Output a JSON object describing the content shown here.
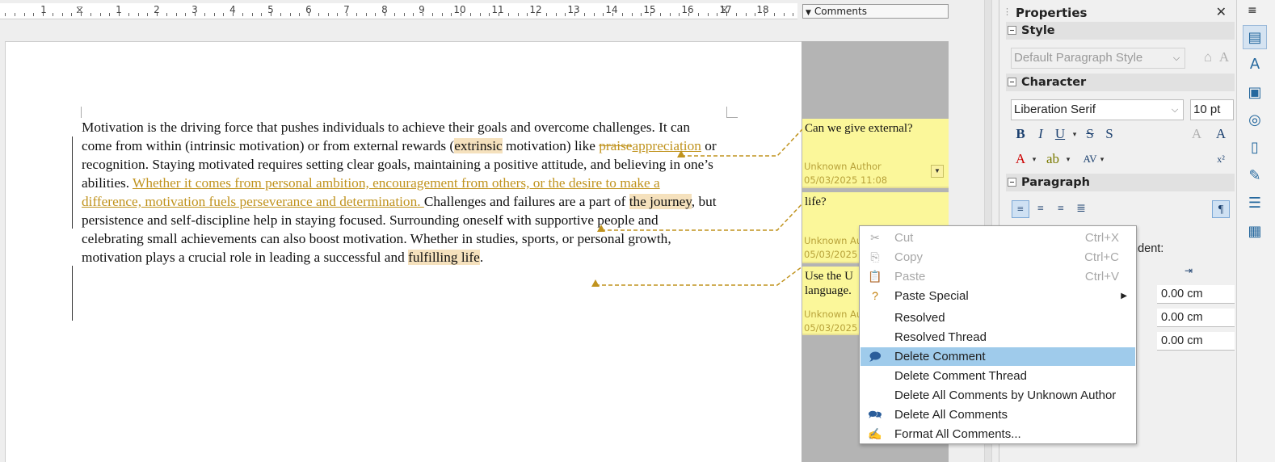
{
  "ruler": {
    "numbers": [
      "1",
      "1",
      "2",
      "3",
      "4",
      "5",
      "6",
      "7",
      "8",
      "9",
      "10",
      "11",
      "12",
      "13",
      "14",
      "15",
      "16",
      "17",
      "18"
    ],
    "comments_dropdown": "Comments"
  },
  "document": {
    "p1": "Motivation is the driving force that pushes individuals to achieve their goals and overcome challenges. It can come from within (intrinsic motivation) or from external rewards (",
    "hl1": "extrinsic",
    "p2": " motivation) like ",
    "del1": "praise",
    "ins1": "appreciation",
    "p3": " or recognition. Staying motivated requires setting clear goals, maintaining a positive attitude, and believing in one’s abilities. ",
    "ins2": "Whether it comes from personal ambition, encouragement from others, or the desire to make a difference, motivation fuels perseverance and determination. ",
    "p4": "Challenges and failures are a part of ",
    "hl2": "the journey",
    "p5": ", but persistence and self-discipline help in staying focused. Surrounding oneself with supportive people and celebrating small achievements can also boost motivation. Whether in studies, sports, or personal growth, motivation plays a crucial role in leading a successful and ",
    "hl3": "fulfilling life",
    "p6": "."
  },
  "comments": [
    {
      "text": "Can we give external?",
      "author": "Unknown Author",
      "date": "05/03/2025 11:08"
    },
    {
      "text": "life?",
      "author": "Unknown Au",
      "date": "05/03/2025"
    },
    {
      "text": "Use the U",
      "text2": "language.",
      "author": "Unknown Au",
      "date": "05/03/2025"
    }
  ],
  "context_menu": {
    "cut": "Cut",
    "cut_sc": "Ctrl+X",
    "copy": "Copy",
    "copy_sc": "Ctrl+C",
    "paste": "Paste",
    "paste_sc": "Ctrl+V",
    "paste_special": "Paste Special",
    "resolved": "Resolved",
    "resolved_thread": "Resolved Thread",
    "delete_comment": "Delete Comment",
    "delete_comment_thread": "Delete Comment Thread",
    "delete_all_by_author": "Delete All Comments by Unknown Author",
    "delete_all": "Delete All Comments",
    "format_all": "Format All Comments..."
  },
  "sidebar": {
    "title": "Properties",
    "style_section": "Style",
    "paragraph_style": "Default Paragraph Style",
    "character_section": "Character",
    "font_name": "Liberation Serif",
    "font_size": "10 pt",
    "paragraph_section": "Paragraph",
    "indent_label": "ndent:",
    "indent_before": "0.00 cm",
    "indent_after": "0.00 cm",
    "indent_first": "0.00 cm"
  },
  "colors": {
    "comment_bg": "#fbf79a",
    "track_change": "#c0931e",
    "highlight": "#f5e1bd",
    "menu_selected": "#9fcbeb"
  }
}
